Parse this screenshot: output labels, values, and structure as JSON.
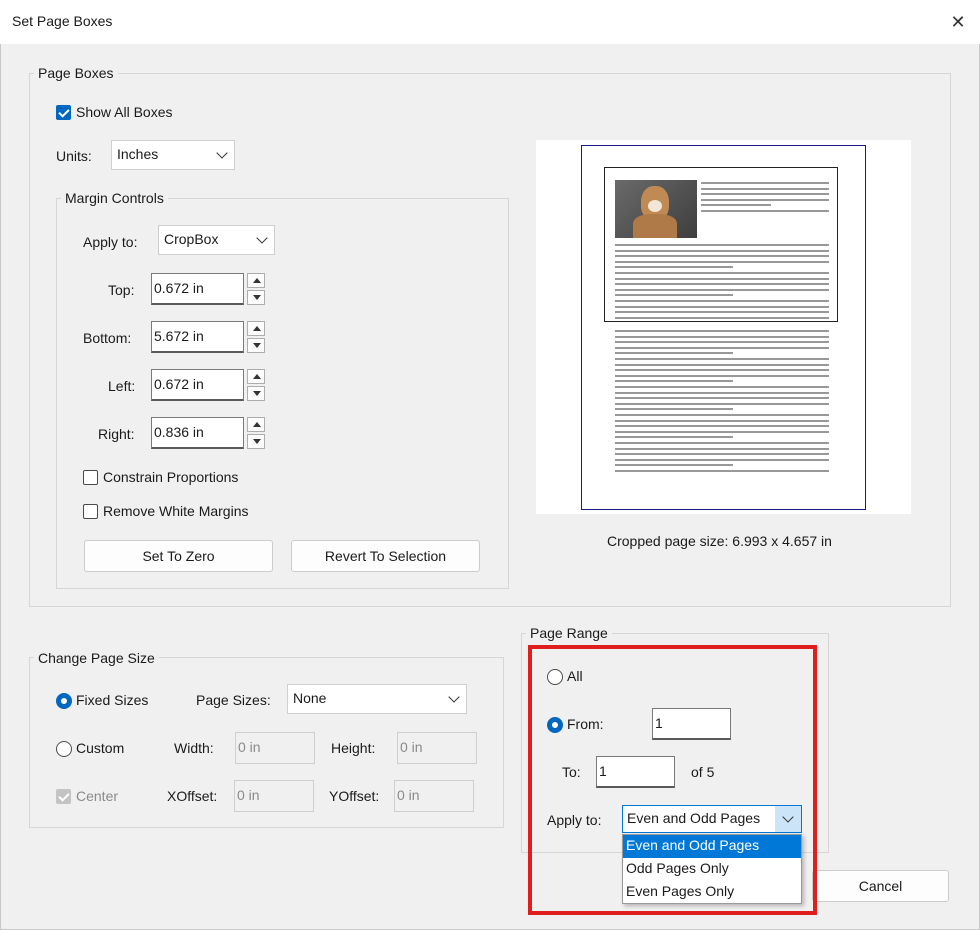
{
  "window": {
    "title": "Set Page Boxes"
  },
  "page_boxes": {
    "legend": "Page Boxes",
    "show_all_boxes": {
      "label": "Show All Boxes",
      "checked": true
    },
    "units": {
      "label": "Units:",
      "value": "Inches"
    },
    "margin_controls": {
      "legend": "Margin Controls",
      "apply_to": {
        "label": "Apply to:",
        "value": "CropBox"
      },
      "top": {
        "label": "Top:",
        "value": "0.672 in"
      },
      "bottom": {
        "label": "Bottom:",
        "value": "5.672 in"
      },
      "left": {
        "label": "Left:",
        "value": "0.672 in"
      },
      "right": {
        "label": "Right:",
        "value": "0.836 in"
      },
      "constrain_proportions": {
        "label": "Constrain Proportions",
        "checked": false
      },
      "remove_white_margins": {
        "label": "Remove White Margins",
        "checked": false
      },
      "set_to_zero": "Set To Zero",
      "revert_to_selection": "Revert To Selection"
    },
    "cropped_size": "Cropped page size: 6.993 x 4.657 in"
  },
  "change_page_size": {
    "legend": "Change Page Size",
    "fixed_sizes": {
      "label": "Fixed Sizes",
      "selected": true
    },
    "page_sizes": {
      "label": "Page Sizes:",
      "value": "None"
    },
    "custom": {
      "label": "Custom",
      "selected": false
    },
    "width": {
      "label": "Width:",
      "value": "0 in"
    },
    "height": {
      "label": "Height:",
      "value": "0 in"
    },
    "center": {
      "label": "Center",
      "checked": true
    },
    "xoffset": {
      "label": "XOffset:",
      "value": "0 in"
    },
    "yoffset": {
      "label": "YOffset:",
      "value": "0 in"
    }
  },
  "page_range": {
    "legend": "Page Range",
    "all": {
      "label": "All",
      "selected": false
    },
    "from": {
      "label": "From:",
      "value": "1",
      "selected": true
    },
    "to": {
      "label": "To:",
      "value": "1"
    },
    "of_total": "of 5",
    "apply_to": {
      "label": "Apply to:",
      "value": "Even and Odd Pages",
      "options": [
        "Even and Odd Pages",
        "Odd Pages Only",
        "Even Pages Only"
      ]
    }
  },
  "buttons": {
    "cancel": "Cancel"
  },
  "colors": {
    "accent": "#0067c0",
    "highlight": "#e01e1e",
    "selection": "#0078d7"
  }
}
